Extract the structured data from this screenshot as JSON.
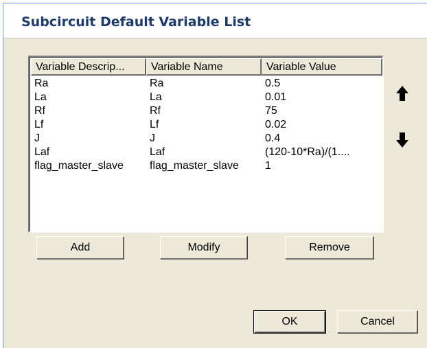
{
  "dialog": {
    "title": "Subcircuit Default Variable List"
  },
  "table": {
    "columns": [
      "Variable Descrip...",
      "Variable Name",
      "Variable Value"
    ],
    "rows": [
      {
        "description": "Ra",
        "name": "Ra",
        "value": "0.5"
      },
      {
        "description": "La",
        "name": "La",
        "value": "0.01"
      },
      {
        "description": "Rf",
        "name": "Rf",
        "value": "75"
      },
      {
        "description": "Lf",
        "name": "Lf",
        "value": "0.02"
      },
      {
        "description": "J",
        "name": "J",
        "value": "0.4"
      },
      {
        "description": "Laf",
        "name": "Laf",
        "value": "(120-10*Ra)/(1...."
      },
      {
        "description": "flag_master_slave",
        "name": "flag_master_slave",
        "value": "1"
      }
    ]
  },
  "icons": {
    "move_up": "arrow-up-icon",
    "move_down": "arrow-down-icon"
  },
  "buttons": {
    "add": "Add",
    "modify": "Modify",
    "remove": "Remove",
    "ok": "OK",
    "cancel": "Cancel"
  }
}
